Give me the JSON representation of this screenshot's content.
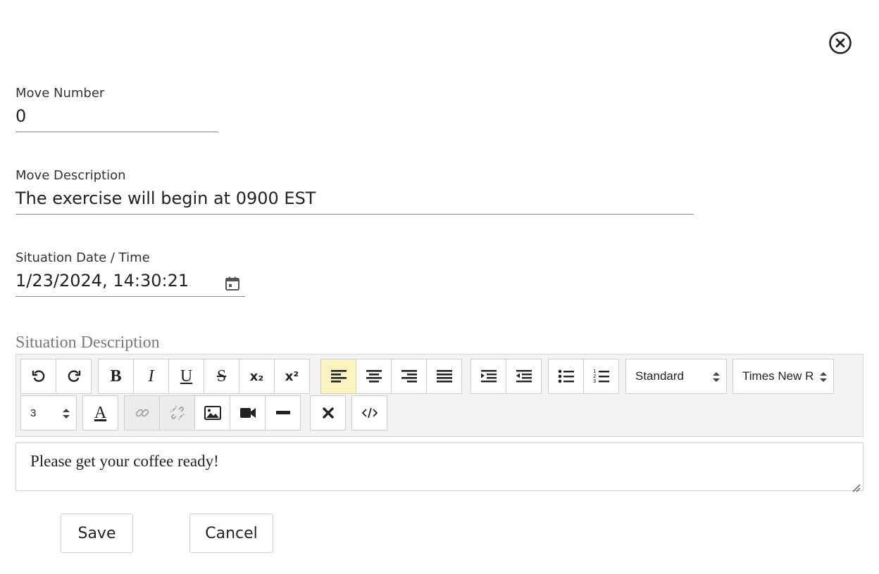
{
  "icons": {
    "close": "close-circle-icon",
    "calendar": "calendar-icon"
  },
  "form": {
    "move_number": {
      "label": "Move Number",
      "value": "0"
    },
    "move_description": {
      "label": "Move Description",
      "value": "The exercise will begin at 0900 EST"
    },
    "situation_datetime": {
      "label": "Situation Date / Time",
      "value": "1/23/2024, 14:30:21"
    },
    "situation_description": {
      "label": "Situation Description",
      "content": "Please get your coffee ready!"
    }
  },
  "toolbar": {
    "bold": "B",
    "italic": "I",
    "underline": "U",
    "strike": "S",
    "subscript": "x₂",
    "superscript": "x²",
    "format_select": "Standard",
    "font_select": "Times New R",
    "size_select": "3",
    "font_color": "A",
    "active_color": "#fbf3c0"
  },
  "actions": {
    "save": "Save",
    "cancel": "Cancel"
  }
}
